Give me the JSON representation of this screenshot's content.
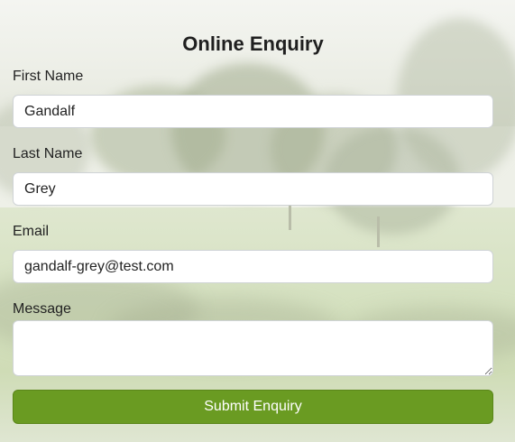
{
  "form": {
    "title": "Online Enquiry",
    "first_name": {
      "label": "First Name",
      "value": "Gandalf"
    },
    "last_name": {
      "label": "Last Name",
      "value": "Grey"
    },
    "email": {
      "label": "Email",
      "value": "gandalf-grey@test.com"
    },
    "message": {
      "label": "Message",
      "value": ""
    },
    "submit_label": "Submit Enquiry"
  },
  "colors": {
    "submit_button": "#6a9b22",
    "field_background": "#ffffff",
    "field_border": "#cfd3d6"
  }
}
